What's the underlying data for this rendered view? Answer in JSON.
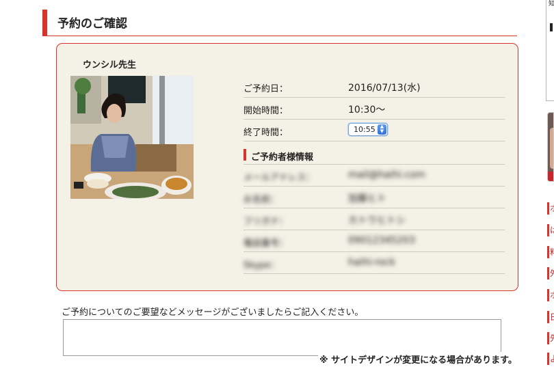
{
  "page": {
    "title": "予約のご確認"
  },
  "teacher": {
    "name": "ウンシル先生"
  },
  "reservation": {
    "date_label": "ご予約日：",
    "date_value": "2016/07/13(水)",
    "start_label": "開始時間：",
    "start_value": "10:30〜",
    "end_label": "終了時間：",
    "end_value": "10:55",
    "end_arrows": "▲▼"
  },
  "booker": {
    "heading": "ご予約者様情報",
    "rows": [
      {
        "label": "メールアドレス：",
        "value": "mail@haihi.com"
      },
      {
        "label": "お名前：",
        "value": "加藤ヒト"
      },
      {
        "label": "フリガナ：",
        "value": "カトウヒトシ"
      },
      {
        "label": "電話番号：",
        "value": "09012345203"
      },
      {
        "label": "Skype：",
        "value": "haihi-rock"
      }
    ]
  },
  "message": {
    "label": "ご予約についてのご要望などメッセージがございましたらご記入ください。",
    "value": ""
  },
  "notice": "※ サイトデザインが変更になる場合があります。",
  "sidebar": {
    "box_text": "知",
    "links": [
      "ホ",
      "は",
      "料",
      "外",
      "ホ",
      "日",
      "先",
      "よ"
    ]
  },
  "colors": {
    "accent": "#d8342b",
    "card_bg": "#f4f1e6"
  }
}
